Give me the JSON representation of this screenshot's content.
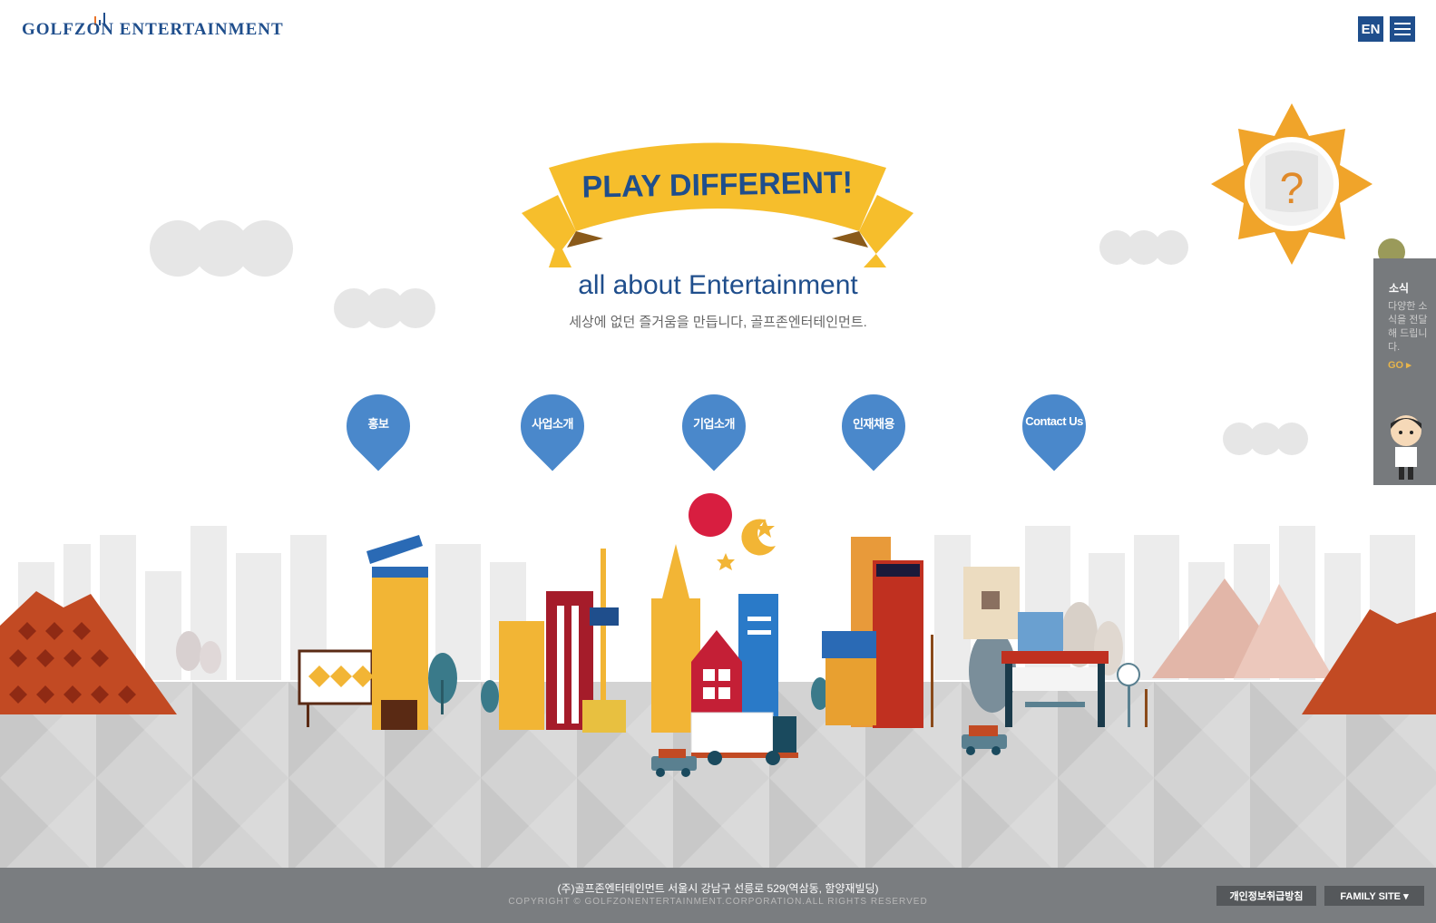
{
  "header": {
    "logo_text": "GOLFZON ENTERTAINMENT",
    "lang_button": "EN",
    "menu_icon": "hamburger-icon"
  },
  "hero": {
    "banner_text": "PLAY DIFFERENT!",
    "tagline": "all about Entertainment",
    "subline": "세상에 없던 즐거움을 만듭니다, 골프존엔터테인먼트.",
    "sun_icon_text": "?"
  },
  "nav_pins": [
    {
      "label": "홍보"
    },
    {
      "label": "사업소개"
    },
    {
      "label": "기업소개"
    },
    {
      "label": "인재채용"
    },
    {
      "label": "Contact Us"
    }
  ],
  "news_panel": {
    "title": "소식",
    "description": "다양한 소식을 전달해 드립니다.",
    "go": "GO ▸"
  },
  "footer": {
    "address": "(주)골프존엔터테인먼트 서울시 강남구 선릉로 529(역삼동, 함양재빌딩)",
    "copyright": "COPYRIGHT © GOLFZONENTERTAINMENT.CORPORATION.ALL RIGHTS RESERVED",
    "privacy_button": "개인정보취급방침",
    "family_site": "FAMILY SITE ▾"
  },
  "colors": {
    "brand_blue": "#1f4e8c",
    "pin_blue": "#4a88cb",
    "banner_yellow": "#f6be2c",
    "sun_orange": "#f0a42a",
    "footer_gray": "#7a7d80"
  }
}
